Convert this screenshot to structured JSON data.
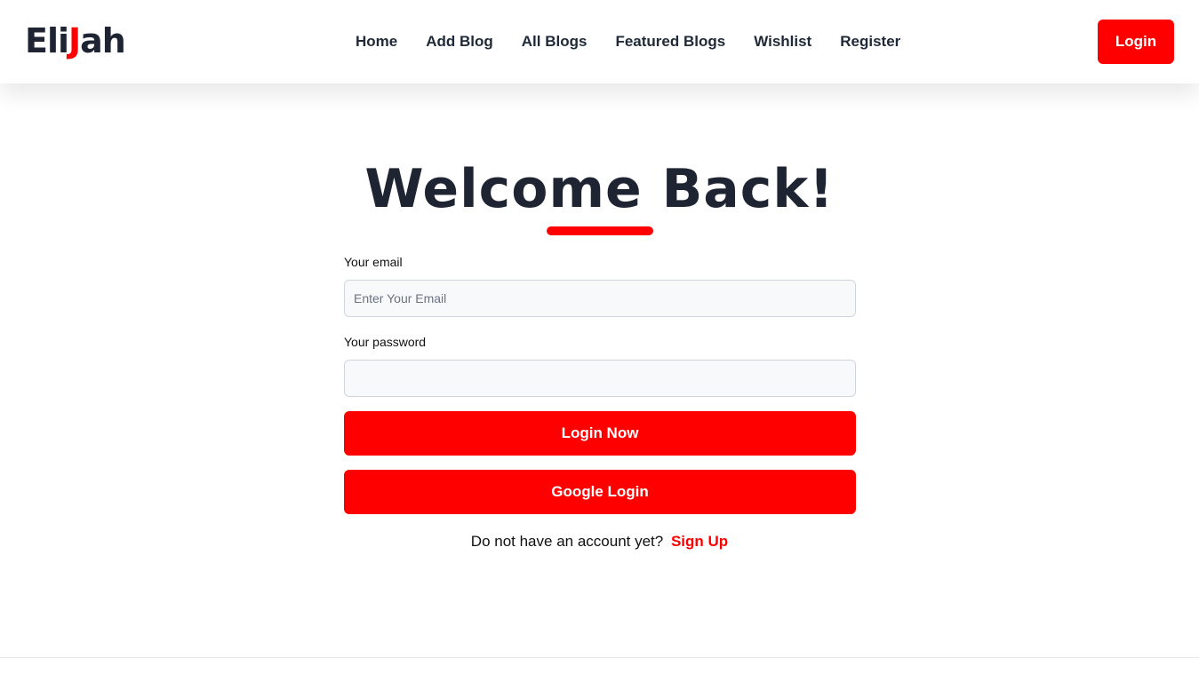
{
  "brand": {
    "logo_left": "Eli",
    "logo_accent": "J",
    "logo_right": "ah"
  },
  "nav": {
    "items": [
      {
        "label": "Home"
      },
      {
        "label": "Add Blog"
      },
      {
        "label": "All Blogs"
      },
      {
        "label": "Featured Blogs"
      },
      {
        "label": "Wishlist"
      },
      {
        "label": "Register"
      }
    ],
    "login_label": "Login"
  },
  "login_form": {
    "title": "Welcome Back!",
    "email_label": "Your email",
    "email_placeholder": "Enter Your Email",
    "email_value": "",
    "password_label": "Your password",
    "password_value": "",
    "submit_label": "Login Now",
    "google_label": "Google Login",
    "signup_prompt": "Do not have an account yet?",
    "signup_link": "Sign Up"
  },
  "colors": {
    "accent": "#ff0000",
    "heading": "#1f2433",
    "input_bg": "#f8f9fb"
  }
}
